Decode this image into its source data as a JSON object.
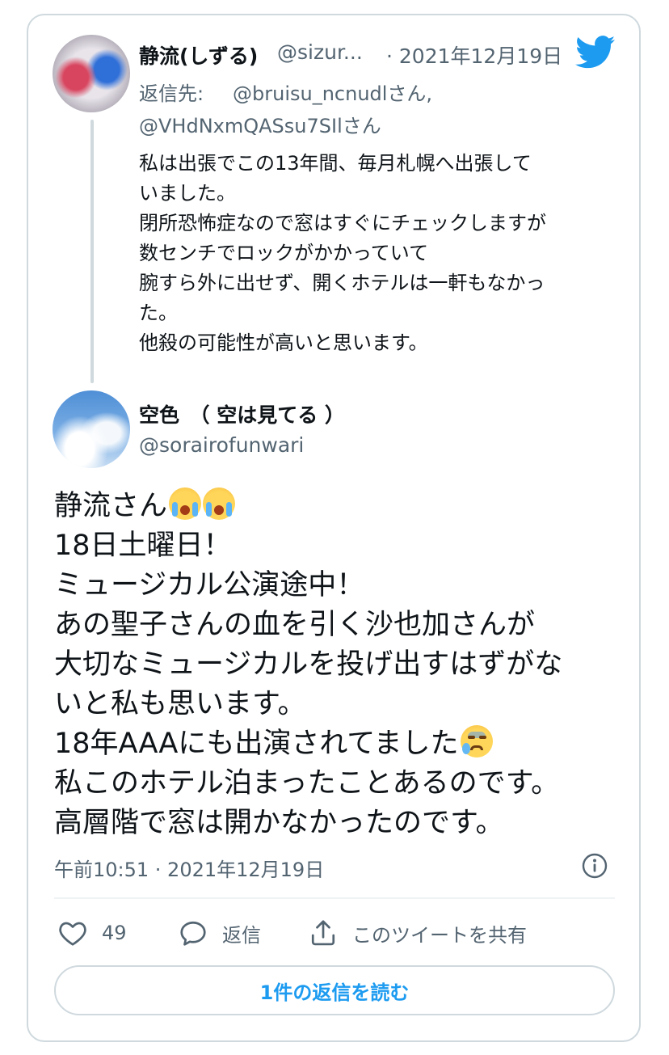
{
  "parent_tweet": {
    "display_name": "静流(しずる)",
    "handle": "@sizur...",
    "date": "· 2021年12月19日",
    "reply_prefix": "返信先:",
    "reply_handle_1": "@bruisu_ncnudlさん,",
    "reply_handle_2": "@VHdNxmQASsu7SIlさん",
    "body_lines": [
      "私は出張でこの13年間、毎月札幌へ出張して",
      "いました。",
      "閉所恐怖症なので窓はすぐにチェックしますが",
      "数センチでロックがかかっていて",
      "腕すら外に出せず、開くホテルは一軒もなかっ",
      "た。",
      "他殺の可能性が高いと思います。"
    ]
  },
  "main_tweet": {
    "display_name": "空色　（ 空は見てる ）",
    "handle": "@sorairofunwari",
    "body_lines": [
      "静流さん",
      "18日土曜日！",
      "ミュージカル公演途中！",
      "あの聖子さんの血を引く沙也加さんが",
      "大切なミュージカルを投げ出すはずがな",
      "いと私も思います。",
      "18年AAAにも出演されてました",
      "私このホテル泊まったことあるのです。",
      "高層階で窓は開かなかったのです。"
    ],
    "timestamp": "午前10:51 · 2021年12月19日"
  },
  "actions": {
    "like_count": "49",
    "reply_label": "返信",
    "share_label": "このツイートを共有"
  },
  "read_replies_label": "1件の返信を読む",
  "icons": {
    "brand": "twitter-bird-icon",
    "like": "heart-icon",
    "reply": "speech-bubble-icon",
    "share": "share-upload-icon",
    "info": "info-icon"
  },
  "colors": {
    "brand_blue": "#1d9bf0",
    "secondary_text": "#536471",
    "border": "#cfd9de"
  }
}
